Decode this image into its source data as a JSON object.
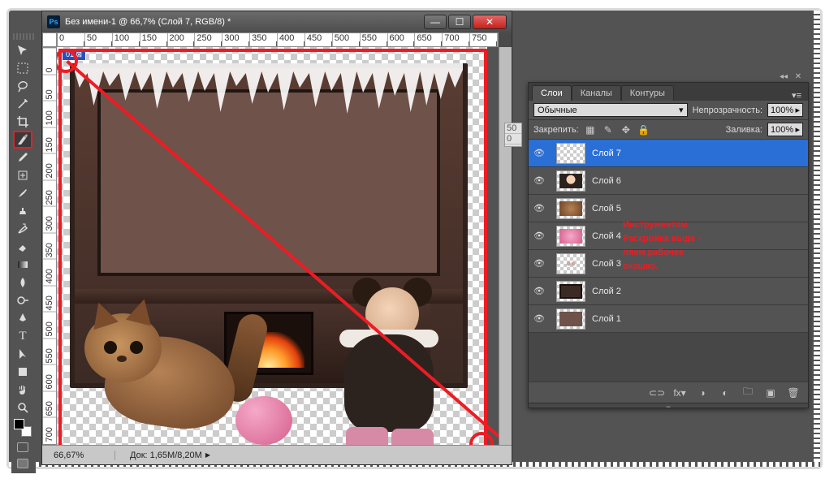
{
  "window": {
    "ps_icon": "Ps",
    "title": "Без имени-1 @ 66,7% (Слой 7, RGB/8) *",
    "controls": {
      "min": "—",
      "max": "☐",
      "close": "✕"
    }
  },
  "rulers": {
    "h": [
      "0",
      "50",
      "100",
      "150",
      "200",
      "250",
      "300",
      "350",
      "400",
      "450",
      "500",
      "550",
      "600",
      "650",
      "700",
      "750"
    ],
    "v": [
      "0",
      "50",
      "100",
      "150",
      "200",
      "250",
      "300",
      "350",
      "400",
      "450",
      "500",
      "550",
      "600",
      "650",
      "700"
    ]
  },
  "status": {
    "zoom": "66,67%",
    "docsize": "Док: 1,65M/8,20M",
    "tri": "▶"
  },
  "slice_badge": "01 ⊠",
  "doc_behind": [
    "50",
    "0"
  ],
  "panel": {
    "tabs": {
      "layers": "Слои",
      "channels": "Каналы",
      "paths": "Контуры",
      "menu": "▾≡"
    },
    "blend_label": "Обычные",
    "blend_caret": "▾",
    "opacity_label": "Непрозрачность:",
    "opacity_value": "100%",
    "lock_label": "Закрепить:",
    "lock_icons": {
      "transparency": "▦",
      "pixels": "✎",
      "position": "✥",
      "all": "🔒"
    },
    "fill_label": "Заливка:",
    "fill_value": "100%",
    "caret": "▸",
    "footer": {
      "link": "⊂⊃",
      "fx": "fx▾",
      "mask": "◑",
      "adjust": "◐",
      "group": "🗀",
      "new": "▣",
      "trash": "🗑"
    }
  },
  "layers": [
    {
      "name": "Слой 7",
      "selected": true,
      "thumb": "transparent"
    },
    {
      "name": "Слой 6",
      "selected": false,
      "thumb": "doll"
    },
    {
      "name": "Слой 5",
      "selected": false,
      "thumb": "cat"
    },
    {
      "name": "Слой 4",
      "selected": false,
      "thumb": "yarn"
    },
    {
      "name": "Слой 3",
      "selected": false,
      "thumb": "dots"
    },
    {
      "name": "Слой 2",
      "selected": false,
      "thumb": "frame"
    },
    {
      "name": "Слой 1",
      "selected": false,
      "thumb": "brown"
    }
  ],
  "eye_icon": "👁",
  "annotation": {
    "line1": "Инструментом",
    "line2": "Раскройка выде -",
    "line3": "ляем рабочее",
    "line4": "окошко."
  },
  "dock": {
    "collapse": "◂◂",
    "close": "✕"
  },
  "colors": {
    "accent_red": "#ec1c24",
    "selection_blue": "#2a6fd6"
  }
}
